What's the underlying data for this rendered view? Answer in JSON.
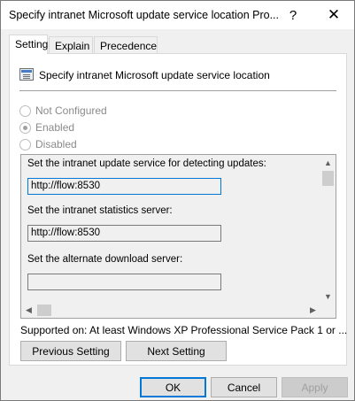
{
  "window": {
    "title": "Specify intranet Microsoft update service location Pro...",
    "help_glyph": "?",
    "close_glyph": "✕"
  },
  "tabs": [
    {
      "label": "Setting",
      "active": true
    },
    {
      "label": "Explain",
      "active": false
    },
    {
      "label": "Precedence",
      "active": false
    }
  ],
  "policy": {
    "name": "Specify intranet Microsoft update service location",
    "icon": "policy-icon"
  },
  "radios": [
    {
      "label": "Not Configured",
      "checked": false,
      "enabled": false
    },
    {
      "label": "Enabled",
      "checked": true,
      "enabled": false
    },
    {
      "label": "Disabled",
      "checked": false,
      "enabled": false
    }
  ],
  "options": {
    "update_service_label": "Set the intranet update service for detecting updates:",
    "update_service_value": "http://flow:8530",
    "statistics_server_label": "Set the intranet statistics server:",
    "statistics_server_value": "http://flow:8530",
    "alternate_download_label": "Set the alternate download server:",
    "alternate_download_value": ""
  },
  "supported": {
    "label": "Supported on:",
    "value": "At least Windows XP Professional Service Pack 1 or ..."
  },
  "nav_buttons": {
    "previous": "Previous Setting",
    "next": "Next Setting"
  },
  "dialog_buttons": {
    "ok": "OK",
    "cancel": "Cancel",
    "apply": "Apply"
  },
  "colors": {
    "accent": "#0078d7",
    "window_bg": "#f0f0f0",
    "disabled_text": "#8a8a8a"
  }
}
